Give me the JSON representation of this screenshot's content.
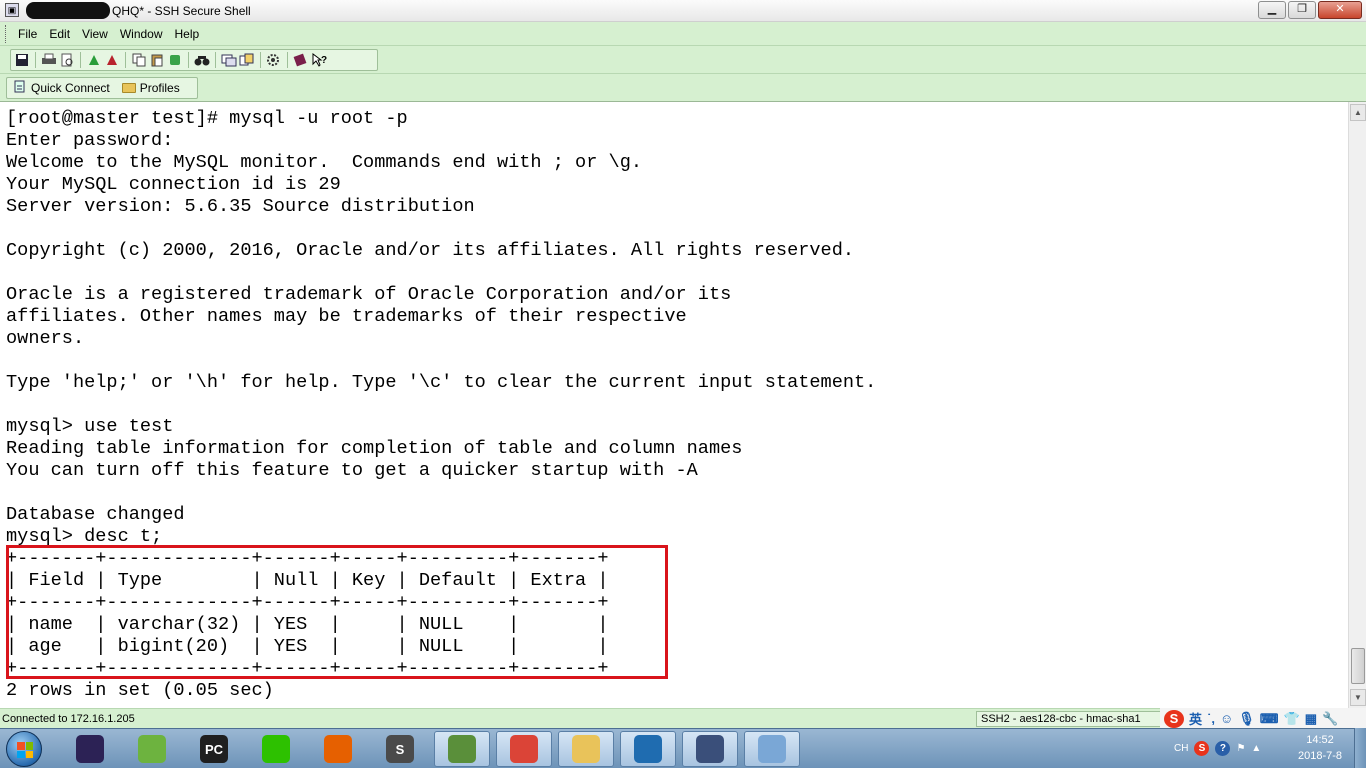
{
  "window": {
    "title": "QHQ* - SSH Secure Shell",
    "buttons": {
      "minimize": "▁",
      "maximize": "❐",
      "close": "✕"
    }
  },
  "menu": [
    "File",
    "Edit",
    "View",
    "Window",
    "Help"
  ],
  "toolbar_icons": [
    "save-icon",
    "print-icon",
    "print-preview-icon",
    "connect-icon",
    "disconnect-icon",
    "copy-icon",
    "paste-icon",
    "clear-icon",
    "find-icon",
    "new-terminal-icon",
    "new-file-transfer-icon",
    "settings-icon",
    "help-book-icon",
    "context-help-icon"
  ],
  "quickbar": {
    "quick_connect": "Quick Connect",
    "profiles": "Profiles"
  },
  "terminal": {
    "lines": [
      "[root@master test]# mysql -u root -p",
      "Enter password:",
      "Welcome to the MySQL monitor.  Commands end with ; or \\g.",
      "Your MySQL connection id is 29",
      "Server version: 5.6.35 Source distribution",
      "",
      "Copyright (c) 2000, 2016, Oracle and/or its affiliates. All rights reserved.",
      "",
      "Oracle is a registered trademark of Oracle Corporation and/or its",
      "affiliates. Other names may be trademarks of their respective",
      "owners.",
      "",
      "Type 'help;' or '\\h' for help. Type '\\c' to clear the current input statement.",
      "",
      "mysql> use test",
      "Reading table information for completion of table and column names",
      "You can turn off this feature to get a quicker startup with -A",
      "",
      "Database changed",
      "mysql> desc t;",
      "+-------+-------------+------+-----+---------+-------+",
      "| Field | Type        | Null | Key | Default | Extra |",
      "+-------+-------------+------+-----+---------+-------+",
      "| name  | varchar(32) | YES  |     | NULL    |       |",
      "| age   | bigint(20)  | YES  |     | NULL    |       |",
      "+-------+-------------+------+-----+---------+-------+",
      "2 rows in set (0.05 sec)"
    ]
  },
  "status": {
    "connection": "Connected to 172.16.1.205",
    "encryption": "SSH2 - aes128-cbc - hmac-sha1"
  },
  "ime": {
    "lang": "英"
  },
  "taskbar": {
    "apps": [
      {
        "name": "eclipse-icon",
        "label": "",
        "color": "#2c2255"
      },
      {
        "name": "spring-icon",
        "label": "",
        "color": "#6db33f"
      },
      {
        "name": "pycharm-icon",
        "label": "PC",
        "color": "#1f1f1f"
      },
      {
        "name": "wechat-icon",
        "label": "",
        "color": "#2dc100"
      },
      {
        "name": "firefox-icon",
        "label": "",
        "color": "#e66000"
      },
      {
        "name": "sublime-icon",
        "label": "S",
        "color": "#4a4a4a"
      },
      {
        "name": "notepad-icon",
        "label": "",
        "color": "#5a8f3a"
      },
      {
        "name": "chrome-icon",
        "label": "",
        "color": "#db4437"
      },
      {
        "name": "explorer-icon",
        "label": "",
        "color": "#e9c35a"
      },
      {
        "name": "virtualbox-icon",
        "label": "",
        "color": "#1f6cb0"
      },
      {
        "name": "ssh-client-icon",
        "label": "",
        "color": "#3a4f7a"
      },
      {
        "name": "paint-icon",
        "label": "",
        "color": "#7aa7d6"
      }
    ],
    "tray": {
      "lang": "CH"
    },
    "clock": {
      "time": "14:52",
      "date": "2018-7-8"
    }
  }
}
